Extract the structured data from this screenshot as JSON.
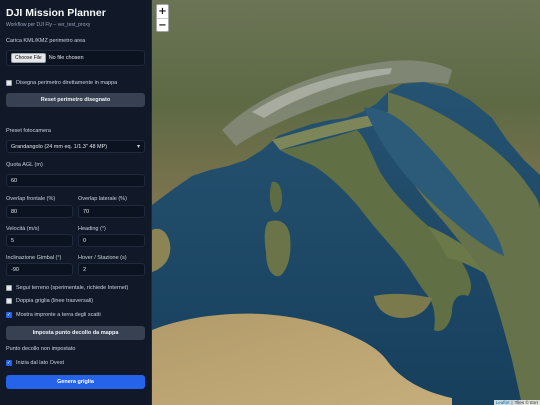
{
  "app": {
    "title": "DJI Mission Planner",
    "subtitle": "Workflow per DJI Fly – ver_test_proxy"
  },
  "upload": {
    "label": "Carica KML/KMZ perimetro area",
    "button": "Choose File",
    "status": "No file chosen"
  },
  "draw": {
    "checkbox_label": "Disegna perimetro direttamente in mappa",
    "checked": false,
    "reset_button": "Reset perimetro disegnato"
  },
  "camera": {
    "label": "Preset fotocamera",
    "selected": "Grandangolo (24 mm eq. 1/1.3\" 48 MP)"
  },
  "params": {
    "quota_label": "Quota AGL (m)",
    "quota_value": "60",
    "overlap_front_label": "Overlap frontale (%)",
    "overlap_front_value": "80",
    "overlap_side_label": "Overlap laterale (%)",
    "overlap_side_value": "70",
    "speed_label": "Velocità (m/s)",
    "speed_value": "5",
    "heading_label": "Heading (°)",
    "heading_value": "0",
    "gimbal_label": "Inclinazione Gimbal (°)",
    "gimbal_value": "-90",
    "hover_label": "Hover / Stazione (s)",
    "hover_value": "2"
  },
  "options": {
    "terrain_label": "Segui terreno (sperimentale, richiede Internet)",
    "terrain_checked": false,
    "double_grid_label": "Doppia griglia (linee trasversali)",
    "double_grid_checked": false,
    "footprints_label": "Mostra impronte a terra degli scatti",
    "footprints_checked": true
  },
  "takeoff": {
    "button": "Imposta punto decollo da mappa",
    "status": "Punto decollo non impostato",
    "west_label": "Inizia dal lato Ovest",
    "west_checked": true
  },
  "generate_button": "Genera griglia",
  "map": {
    "zoom_in": "+",
    "zoom_out": "−",
    "attribution_leaflet": "Leaflet",
    "attribution_sep": "|",
    "attribution_tiles": "Tiles © Esri"
  },
  "colors": {
    "sidebar_bg": "#111827",
    "accent": "#2563eb",
    "secondary_button": "#374151",
    "sea": "#1e4a6a"
  },
  "icons": {
    "select_chevron": "chevron-down-icon",
    "checkmark": "check-icon"
  }
}
